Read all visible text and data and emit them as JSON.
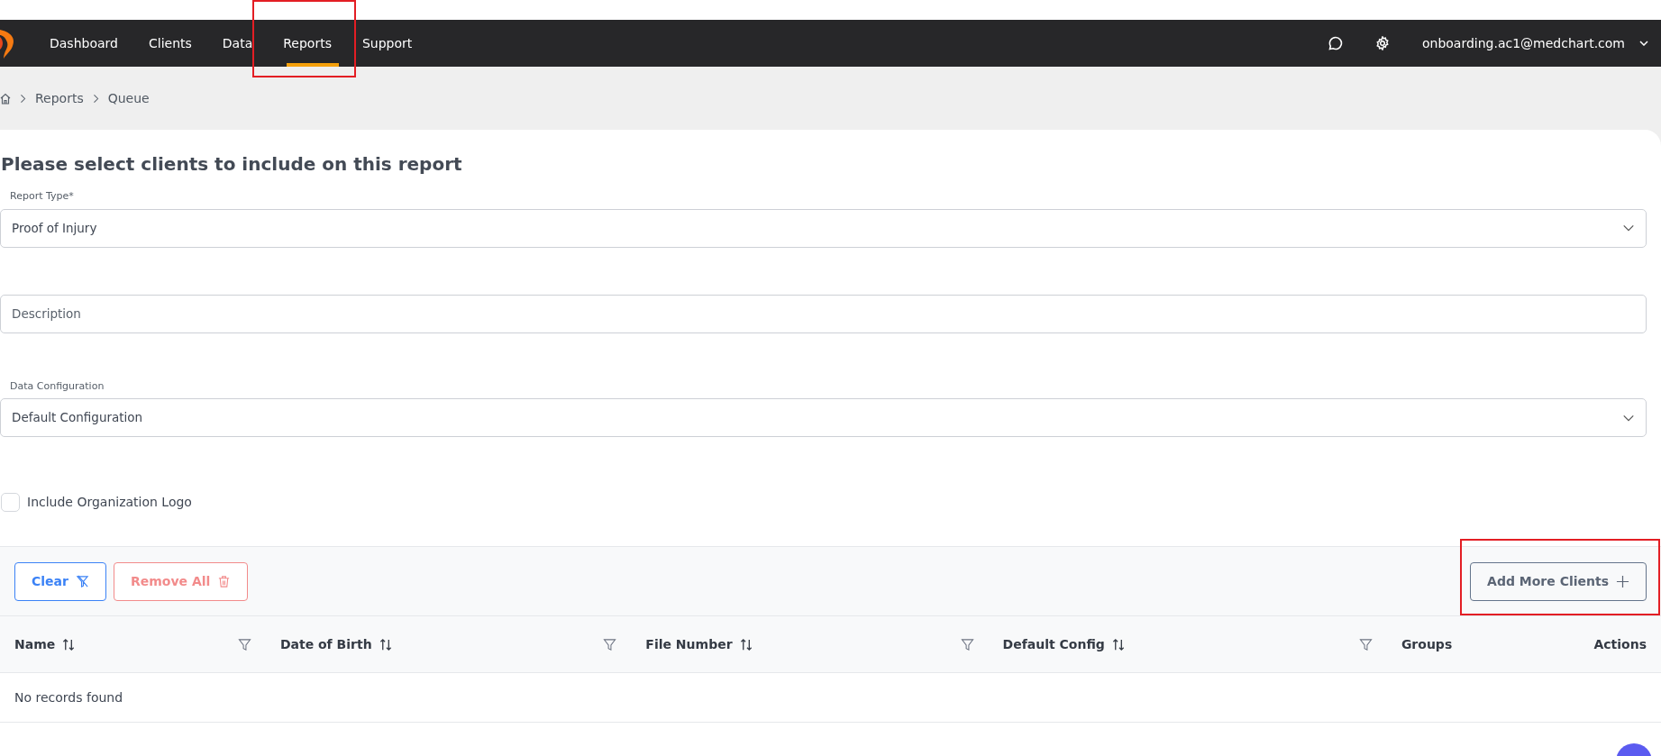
{
  "navbar": {
    "items": [
      {
        "label": "Dashboard",
        "selected": false,
        "highlighted": false
      },
      {
        "label": "Clients",
        "selected": false,
        "highlighted": false
      },
      {
        "label": "Data",
        "selected": false,
        "highlighted": false
      },
      {
        "label": "Reports",
        "selected": true,
        "highlighted": true
      },
      {
        "label": "Support",
        "selected": false,
        "highlighted": false
      }
    ],
    "user": "onboarding.ac1@medchart.com"
  },
  "breadcrumb": [
    "Reports",
    "Queue"
  ],
  "title": "Please select clients to include on this report",
  "fields": [
    {
      "kind": "select",
      "label": "Report Type*",
      "value": "Proof of Injury"
    },
    {
      "kind": "input",
      "placeholder": "Description"
    },
    {
      "kind": "select",
      "label": "Data Configuration",
      "value": "Default Configuration"
    }
  ],
  "checkbox": {
    "label": "Include Organization Logo",
    "checked": false
  },
  "toolbar": {
    "buttons": [
      {
        "kind": "clear",
        "label": "Clear",
        "highlighted": false
      },
      {
        "kind": "remove",
        "label": "Remove All",
        "highlighted": false
      },
      {
        "kind": "add",
        "label": "Add More Clients",
        "highlighted": true
      }
    ]
  },
  "table": {
    "columns": [
      {
        "label": "Name",
        "sortable": true,
        "filterable": true
      },
      {
        "label": "Date of Birth",
        "sortable": true,
        "filterable": true
      },
      {
        "label": "File Number",
        "sortable": true,
        "filterable": true
      },
      {
        "label": "Default Config",
        "sortable": true,
        "filterable": true
      },
      {
        "label": "Groups",
        "sortable": false,
        "filterable": false
      },
      {
        "label": "Actions",
        "sortable": false,
        "filterable": false
      }
    ],
    "empty_message": "No records found"
  }
}
